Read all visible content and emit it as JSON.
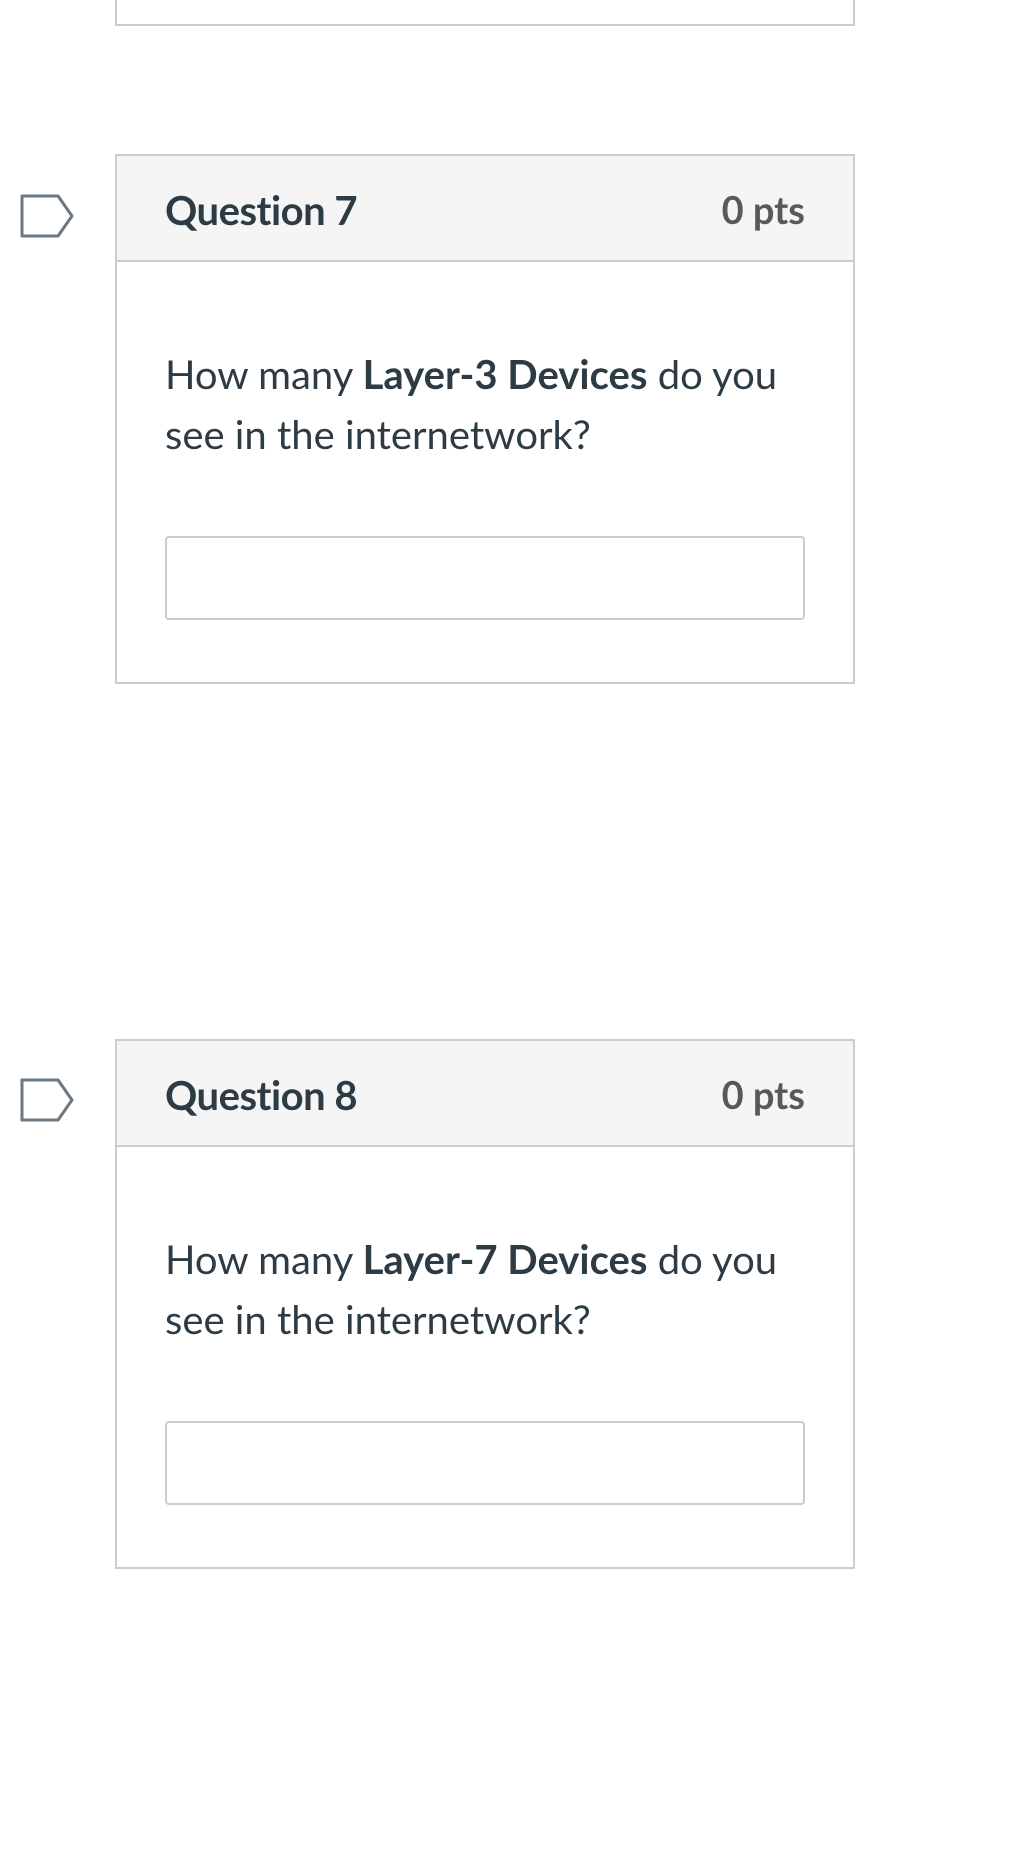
{
  "questions": [
    {
      "title": "Question 7",
      "points": "0 pts",
      "text_pre": "How many ",
      "text_bold": "Layer-3 Devices",
      "text_post": " do you see in the internetwork?",
      "answer_value": ""
    },
    {
      "title": "Question 8",
      "points": "0 pts",
      "text_pre": "How many ",
      "text_bold": "Layer-7 Devices",
      "text_post": " do you see in the internetwork?",
      "answer_value": ""
    }
  ]
}
